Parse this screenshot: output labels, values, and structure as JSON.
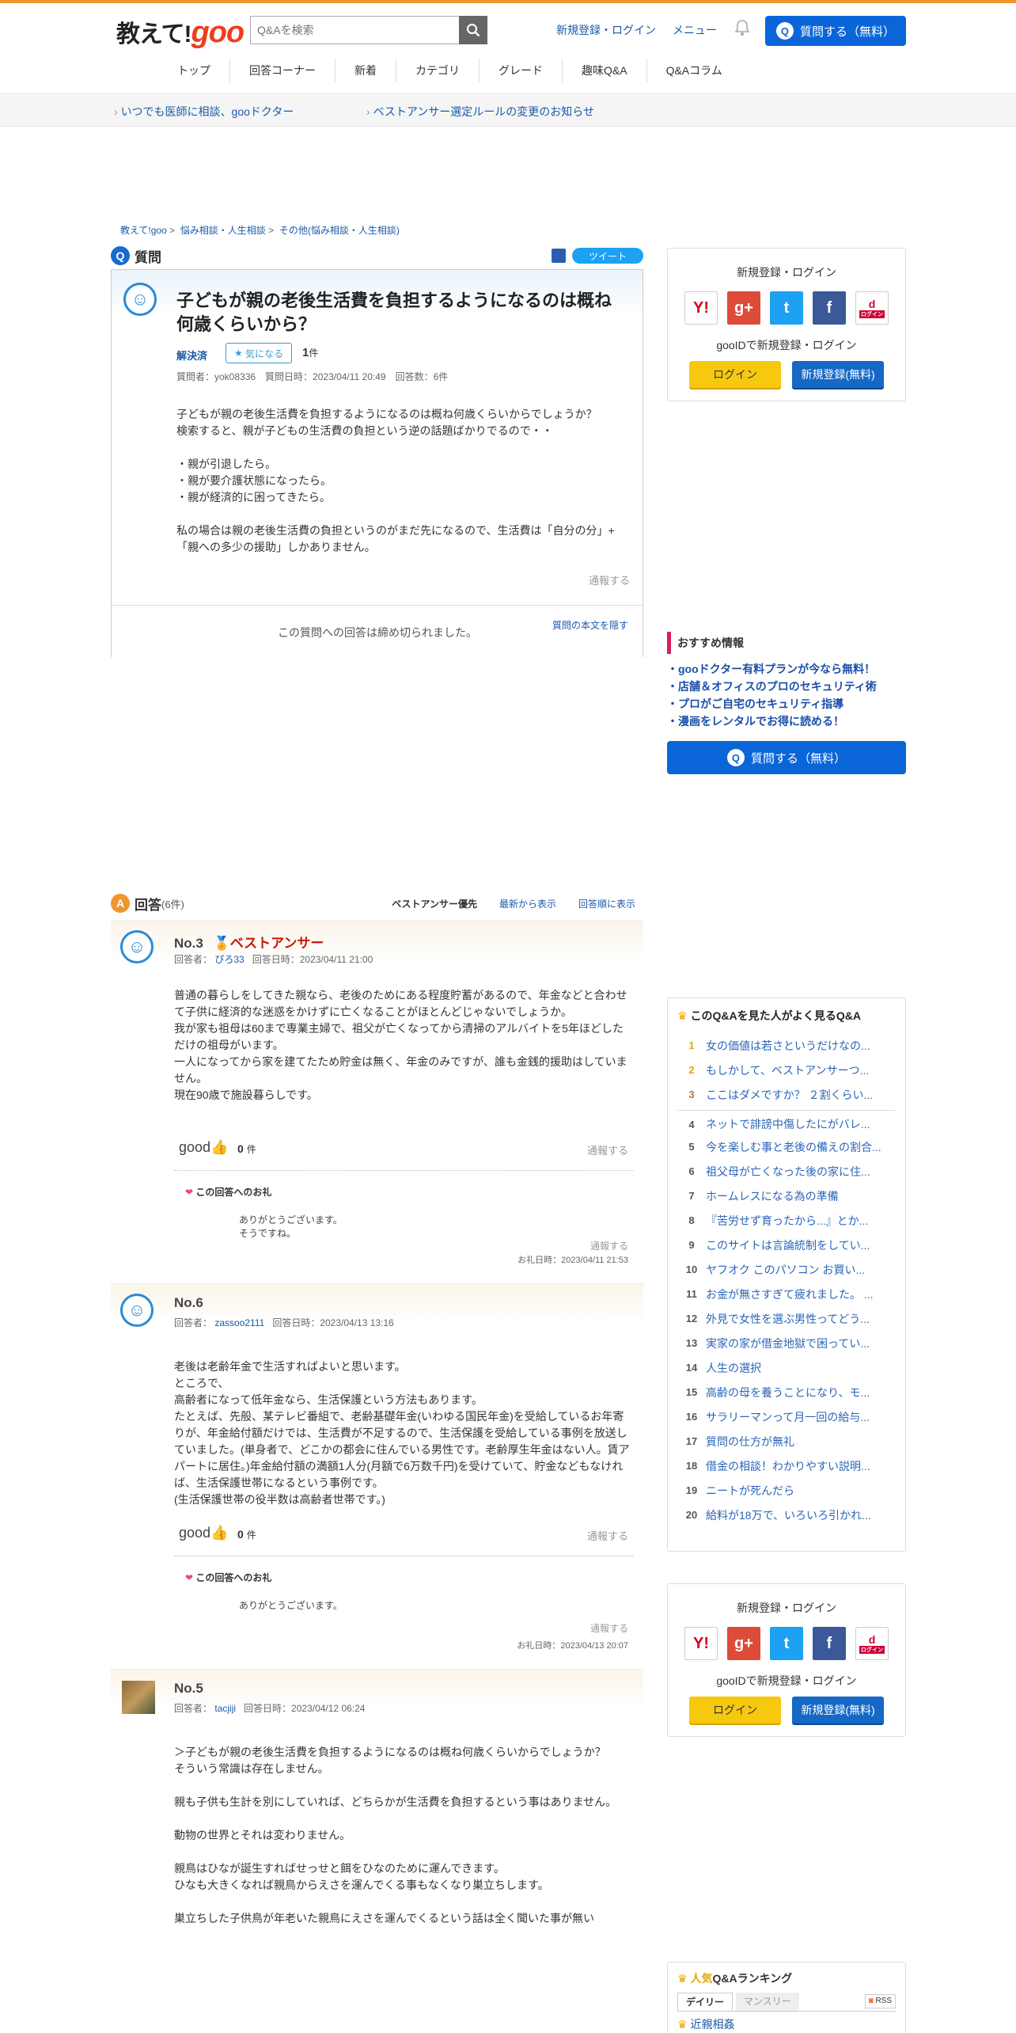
{
  "header": {
    "logo_text": "教えて!",
    "logo_goo": "goo",
    "search_placeholder": "Q&Aを検索",
    "login": "新規登録・ログイン",
    "menu": "メニュー",
    "ask_button": "質問する（無料）",
    "ask_icon": "Q"
  },
  "nav": [
    "トップ",
    "回答コーナー",
    "新着",
    "カテゴリ",
    "グレード",
    "趣味Q&A",
    "Q&Aコラム"
  ],
  "subbar": {
    "link1": "いつでも医師に相談、gooドクター",
    "link2": "ベストアンサー選定ルールの変更のお知らせ"
  },
  "breadcrumb": {
    "c1": "教えて!goo",
    "c2": "悩み相談・人生相談",
    "c3": "その他(悩み相談・人生相談)",
    "sep": ">"
  },
  "question": {
    "section_label": "質問",
    "tweet": "ツイート",
    "title": "子どもが親の老後生活費を負担するようになるのは概ね何歳くらいから？",
    "status": "解決済",
    "fav_label": "気になる",
    "fav_count": "1",
    "fav_unit": "件",
    "meta": "質問者：yok08336　質問日時：2023/04/11 20:49　回答数：6件",
    "body": "子どもが親の老後生活費を負担するようになるのは概ね何歳くらいからでしょうか？\n検索すると、親が子どもの生活費の負担という逆の話題ばかりでるので・・\n\n・親が引退したら。\n・親が要介護状態になったら。\n・親が経済的に困ってきたら。\n\n私の場合は親の老後生活費の負担というのがまだ先になるので、生活費は「自分の分」+「親への多少の援助」しかありません。",
    "report": "通報する",
    "closed": "この質問への回答は締め切られました。",
    "hide_body": "質問の本文を隠す"
  },
  "answers_header": {
    "label": "回答",
    "count": "(6件)",
    "sort1": "ベストアンサー優先",
    "sort2": "最新から表示",
    "sort3": "回答順に表示",
    "icon": "A"
  },
  "answers": [
    {
      "no": "No.3",
      "best": "ベストアンサー",
      "meta_prefix": "回答者：",
      "user": "ぴろ33",
      "date": "回答日時：2023/04/11 21:00",
      "body": "普通の暮らしをしてきた親なら、老後のためにある程度貯蓄があるので、年金などと合わせて子供に経済的な迷惑をかけずに亡くなることがほとんどじゃないでしょうか。\n我が家も祖母は60まで専業主婦で、祖父が亡くなってから清掃のアルバイトを5年ほどしただけの祖母がいます。\n一人になってから家を建てたため貯金は無く、年金のみですが、誰も金銭的援助はしていません。\n現在90歳で施設暮らしです。",
      "good": "good",
      "good_count": "0",
      "good_unit": "件",
      "report": "通報する",
      "thanks_title": "この回答へのお礼",
      "thanks_body": "ありがとうございます。\nそうですね。",
      "thanks_report": "通報する",
      "thanks_date": "お礼日時：2023/04/11 21:53"
    },
    {
      "no": "No.6",
      "meta_prefix": "回答者：",
      "user": "zassoo2111",
      "date": "回答日時：2023/04/13 13:16",
      "body": "老後は老齢年金で生活すればよいと思います。\nところで、\n高齢者になって低年金なら、生活保護という方法もあります。\nたとえば、先般、某テレビ番組で、老齢基礎年金(いわゆる国民年金)を受給しているお年寄りが、年金給付額だけでは、生活費が不足するので、生活保護を受給している事例を放送していました。(単身者で、どこかの都会に住んでいる男性です。老齢厚生年金はない人。賃アパートに居住。)年金給付額の満額1人分(月額で6万数千円)を受けていて、貯金などもなければ、生活保護世帯になるという事例です。\n(生活保護世帯の役半数は高齢者世帯です。)",
      "good": "good",
      "good_count": "0",
      "good_unit": "件",
      "report": "通報する",
      "thanks_title": "この回答へのお礼",
      "thanks_body": "ありがとうございます。",
      "thanks_report": "通報する",
      "thanks_date": "お礼日時：2023/04/13 20:07"
    },
    {
      "no": "No.5",
      "meta_prefix": "回答者：",
      "user": "tacjiji",
      "date": "回答日時：2023/04/12 06:24",
      "body": "＞子どもが親の老後生活費を負担するようになるのは概ね何歳くらいからでしょうか？\nそういう常識は存在しません。\n\n親も子供も生計を別にしていれば、どちらかが生活費を負担するという事はありません。\n\n動物の世界とそれは変わりません。\n\n親鳥はひなが誕生すればせっせと餌をひなのために運んできます。\nひなも大きくなれば親鳥からえさを運んでくる事もなくなり巣立ちします。\n\n巣立ちした子供鳥が年老いた親鳥にえさを運んでくるという話は全く聞いた事が無い"
    }
  ],
  "sidebar": {
    "login_title": "新規登録・ログイン",
    "goo_id": "gooIDで新規登録・ログイン",
    "login_btn": "ログイン",
    "register_btn": "新規登録(無料)",
    "social": [
      "Y!",
      "g+",
      "t",
      "f",
      "d"
    ],
    "docomo_sub": "ログイン",
    "rec_title": "おすすめ情報",
    "rec": [
      "・gooドクター有料プランが今なら無料！",
      "・店舗＆オフィスのプロのセキュリティ術",
      "・プロがご自宅のセキュリティ指導",
      "・漫画をレンタルでお得に読める！"
    ],
    "ask_button": "質問する（無料）",
    "also_title": "このQ&Aを見た人がよく見るQ&A",
    "also": [
      {
        "n": "1",
        "t": "女の価値は若さというだけなの..."
      },
      {
        "n": "2",
        "t": "もしかして、ベストアンサーつ..."
      },
      {
        "n": "3",
        "t": "ここはダメですか？ ２割くらい..."
      },
      {
        "n": "4",
        "t": "ネットで誹謗中傷したにがバレ..."
      },
      {
        "n": "5",
        "t": "今を楽しむ事と老後の備えの割合..."
      },
      {
        "n": "6",
        "t": "祖父母が亡くなった後の家に住..."
      },
      {
        "n": "7",
        "t": "ホームレスになる為の準備"
      },
      {
        "n": "8",
        "t": "『苦労せず育ったから...』とか..."
      },
      {
        "n": "9",
        "t": "このサイトは言論統制をしてい..."
      },
      {
        "n": "10",
        "t": "ヤフオク このパソコン お買い..."
      },
      {
        "n": "11",
        "t": "お金が無さすぎて疲れました。 ..."
      },
      {
        "n": "12",
        "t": "外見で女性を選ぶ男性ってどう..."
      },
      {
        "n": "13",
        "t": "実家の家が借金地獄で困ってい..."
      },
      {
        "n": "14",
        "t": "人生の選択"
      },
      {
        "n": "15",
        "t": "高齢の母を養うことになり、モ..."
      },
      {
        "n": "16",
        "t": "サラリーマンって月一回の給与..."
      },
      {
        "n": "17",
        "t": "質問の仕方が無礼"
      },
      {
        "n": "18",
        "t": "借金の相談！わかりやすい説明..."
      },
      {
        "n": "19",
        "t": "ニートが死んだら"
      },
      {
        "n": "20",
        "t": "給料が18万で、いろいろ引かれ..."
      }
    ],
    "pop_title_a": "人気",
    "pop_title_b": "Q&Aランキング",
    "tab_daily": "デイリー",
    "tab_monthly": "マンスリー",
    "rss": "RSS",
    "pop_first": "近親相姦"
  }
}
